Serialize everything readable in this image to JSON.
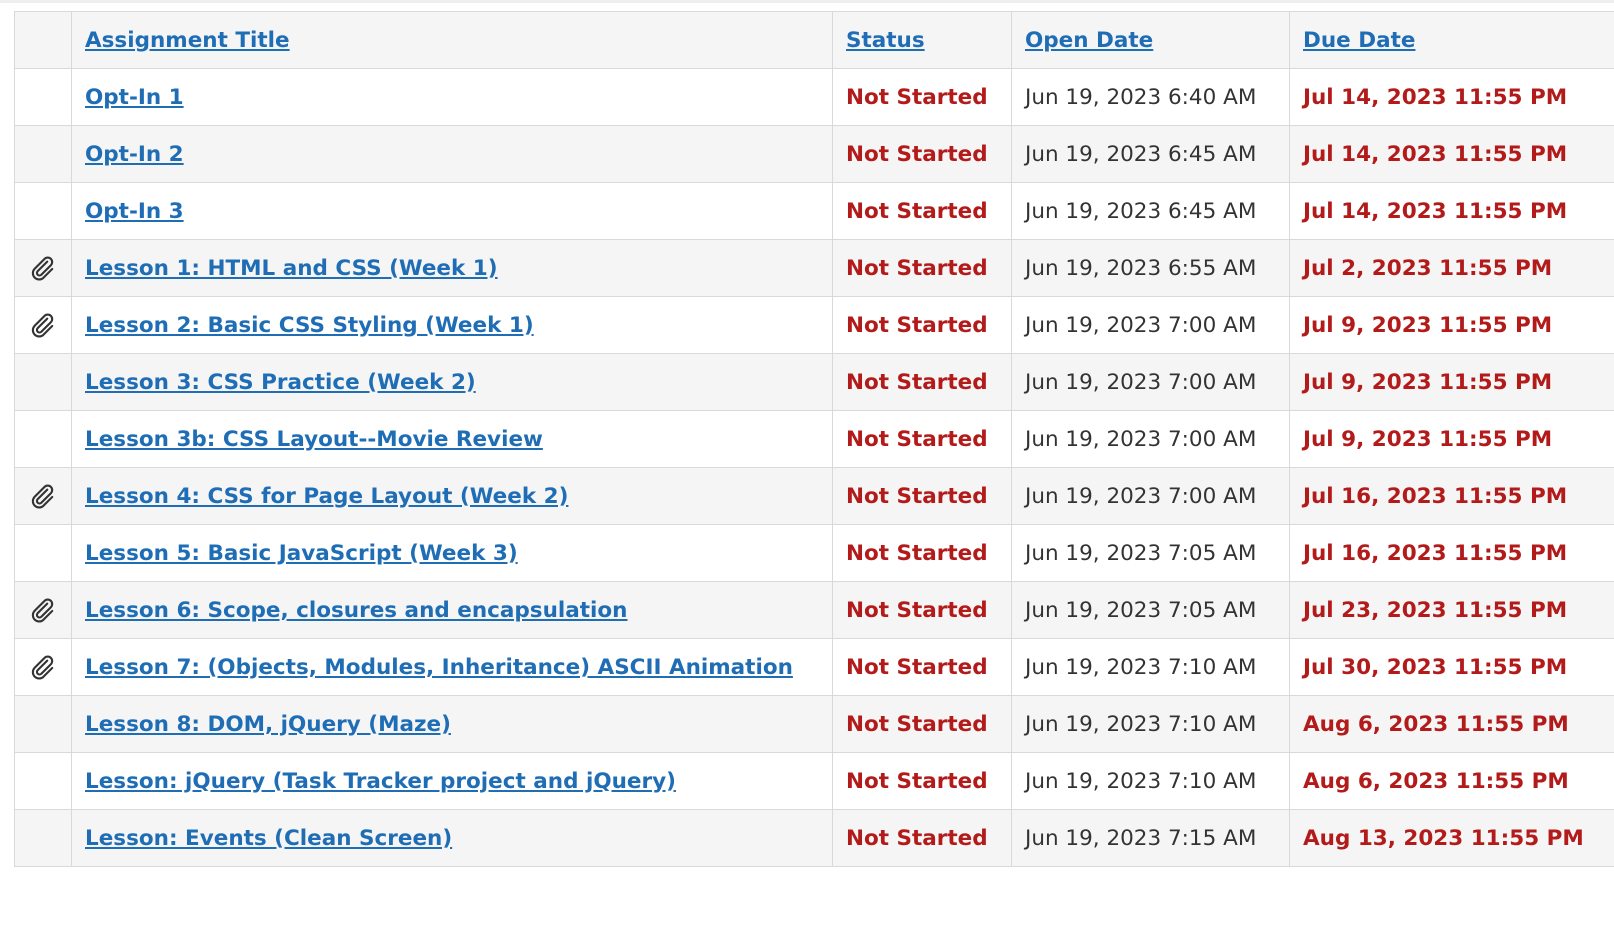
{
  "table": {
    "headers": {
      "title": "Assignment Title",
      "status": "Status",
      "open": "Open Date",
      "due": "Due Date"
    },
    "rows": [
      {
        "attachment": false,
        "title": "Opt-In 1",
        "status": "Not Started",
        "open": "Jun 19, 2023 6:40 AM",
        "due": "Jul 14, 2023 11:55 PM"
      },
      {
        "attachment": false,
        "title": "Opt-In 2",
        "status": "Not Started",
        "open": "Jun 19, 2023 6:45 AM",
        "due": "Jul 14, 2023 11:55 PM"
      },
      {
        "attachment": false,
        "title": "Opt-In 3",
        "status": "Not Started",
        "open": "Jun 19, 2023 6:45 AM",
        "due": "Jul 14, 2023 11:55 PM"
      },
      {
        "attachment": true,
        "title": "Lesson 1: HTML and CSS (Week 1)",
        "status": "Not Started",
        "open": "Jun 19, 2023 6:55 AM",
        "due": "Jul 2, 2023 11:55 PM"
      },
      {
        "attachment": true,
        "title": "Lesson 2: Basic CSS Styling (Week 1)",
        "status": "Not Started",
        "open": "Jun 19, 2023 7:00 AM",
        "due": "Jul 9, 2023 11:55 PM"
      },
      {
        "attachment": false,
        "title": "Lesson 3: CSS Practice (Week 2)",
        "status": "Not Started",
        "open": "Jun 19, 2023 7:00 AM",
        "due": "Jul 9, 2023 11:55 PM"
      },
      {
        "attachment": false,
        "title": "Lesson 3b: CSS Layout--Movie Review",
        "status": "Not Started",
        "open": "Jun 19, 2023 7:00 AM",
        "due": "Jul 9, 2023 11:55 PM"
      },
      {
        "attachment": true,
        "title": "Lesson 4: CSS for Page Layout (Week 2)",
        "status": "Not Started",
        "open": "Jun 19, 2023 7:00 AM",
        "due": "Jul 16, 2023 11:55 PM"
      },
      {
        "attachment": false,
        "title": "Lesson 5: Basic JavaScript (Week 3)",
        "status": "Not Started",
        "open": "Jun 19, 2023 7:05 AM",
        "due": "Jul 16, 2023 11:55 PM"
      },
      {
        "attachment": true,
        "title": "Lesson 6: Scope, closures and encapsulation",
        "status": "Not Started",
        "open": "Jun 19, 2023 7:05 AM",
        "due": "Jul 23, 2023 11:55 PM"
      },
      {
        "attachment": true,
        "title": "Lesson 7: (Objects, Modules, Inheritance) ASCII Animation",
        "status": "Not Started",
        "open": "Jun 19, 2023 7:10 AM",
        "due": "Jul 30, 2023 11:55 PM"
      },
      {
        "attachment": false,
        "title": "Lesson 8: DOM, jQuery (Maze)",
        "status": "Not Started",
        "open": "Jun 19, 2023 7:10 AM",
        "due": "Aug 6, 2023 11:55 PM"
      },
      {
        "attachment": false,
        "title": "Lesson: jQuery (Task Tracker project and jQuery)",
        "status": "Not Started",
        "open": "Jun 19, 2023 7:10 AM",
        "due": "Aug 6, 2023 11:55 PM"
      },
      {
        "attachment": false,
        "title": "Lesson: Events (Clean Screen)",
        "status": "Not Started",
        "open": "Jun 19, 2023 7:15 AM",
        "due": "Aug 13, 2023 11:55 PM"
      }
    ]
  },
  "icons": {
    "attachment": "paperclip-icon"
  },
  "colors": {
    "link": "#1f6eb5",
    "status": "#b31b1b",
    "due": "#b31b1b",
    "row_alt": "#f5f5f5",
    "border": "#d9d9d9"
  }
}
